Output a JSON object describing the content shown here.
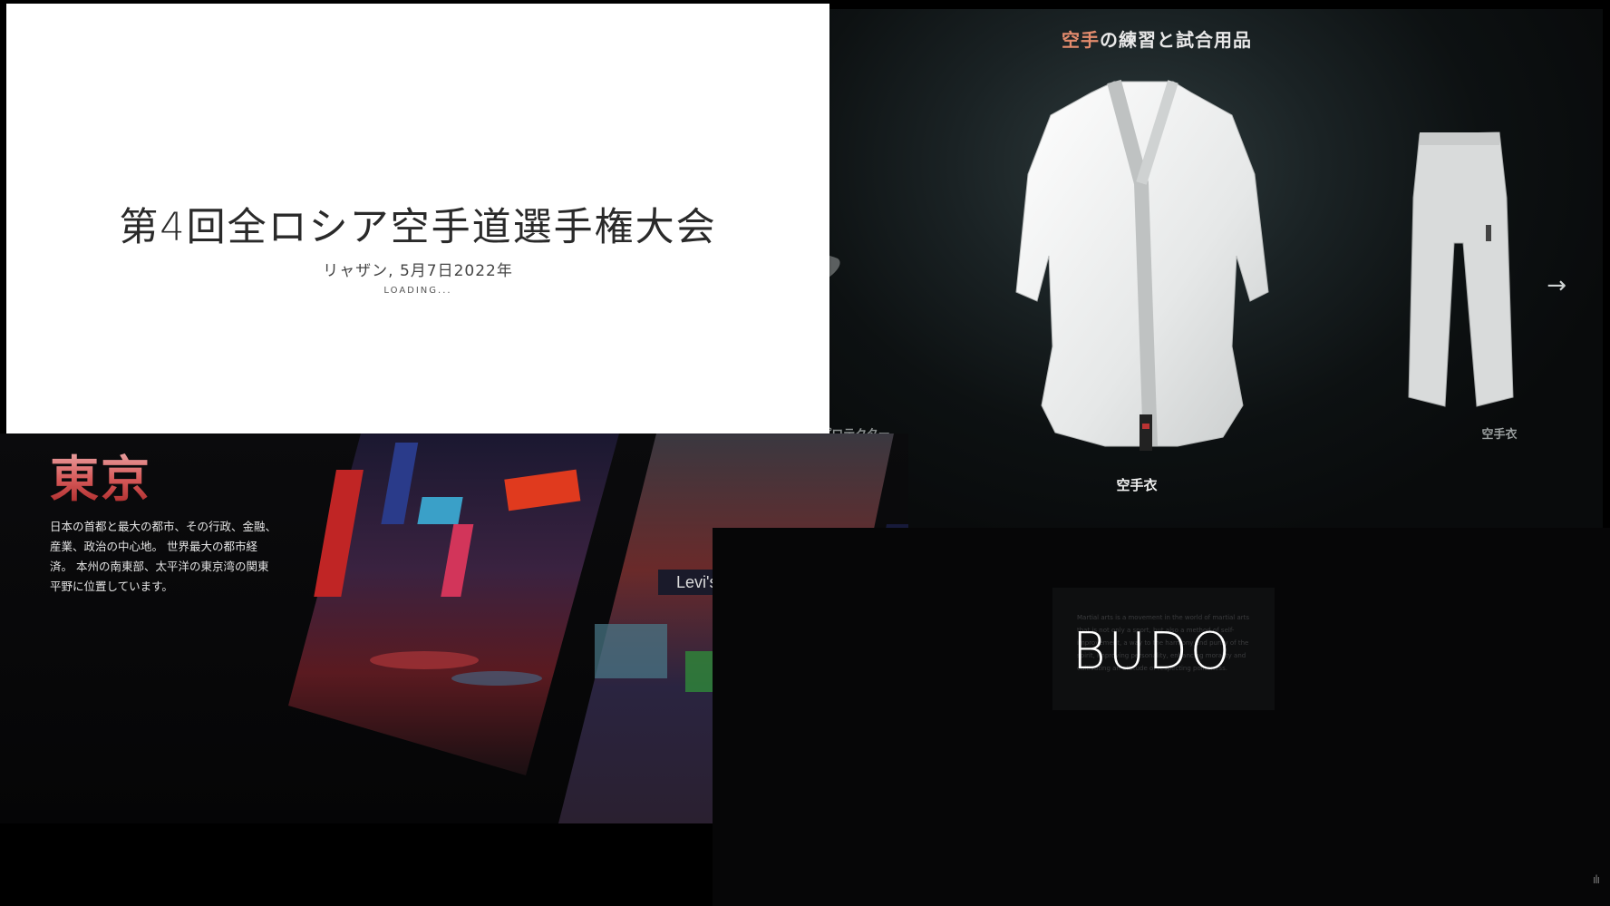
{
  "gear": {
    "title_accent": "空手",
    "title_rest": "の練習と試合用品",
    "items": [
      {
        "label": "ボディプロテクター"
      },
      {
        "label": "空手衣"
      },
      {
        "label": "空手衣"
      }
    ],
    "next_icon": "arrow-right-icon"
  },
  "loading": {
    "title": "第4回全ロシア空手道選手権大会",
    "subtitle": "リャザン, 5月7日2022年",
    "status": "LOADING..."
  },
  "tokyo": {
    "title": "東京",
    "description": "日本の首都と最大の都市、その行政、金融、産業、政治の中心地。 世界最大の都市経済。 本州の南東部、太平洋の東京湾の関東平野に位置しています。",
    "photos": [
      {
        "alt": "rainy-street-night-photo"
      },
      {
        "alt": "levis-store-crosswalk-photo"
      },
      {
        "alt": "neon-street-photo"
      }
    ]
  },
  "budo": {
    "word": "BUDO",
    "small_text": "Martial arts is a movement in the world of martial arts that is not only a sport, but also a method of self-improvement, a way to the harmony and purity of the spirit, improving personality, enhancing morality and cultivating an attitude of respecting politeness.",
    "audio_icon": "sound-wave-icon"
  },
  "colors": {
    "accent": "#e38b6d",
    "tokyo_red": "#d75b5b"
  }
}
